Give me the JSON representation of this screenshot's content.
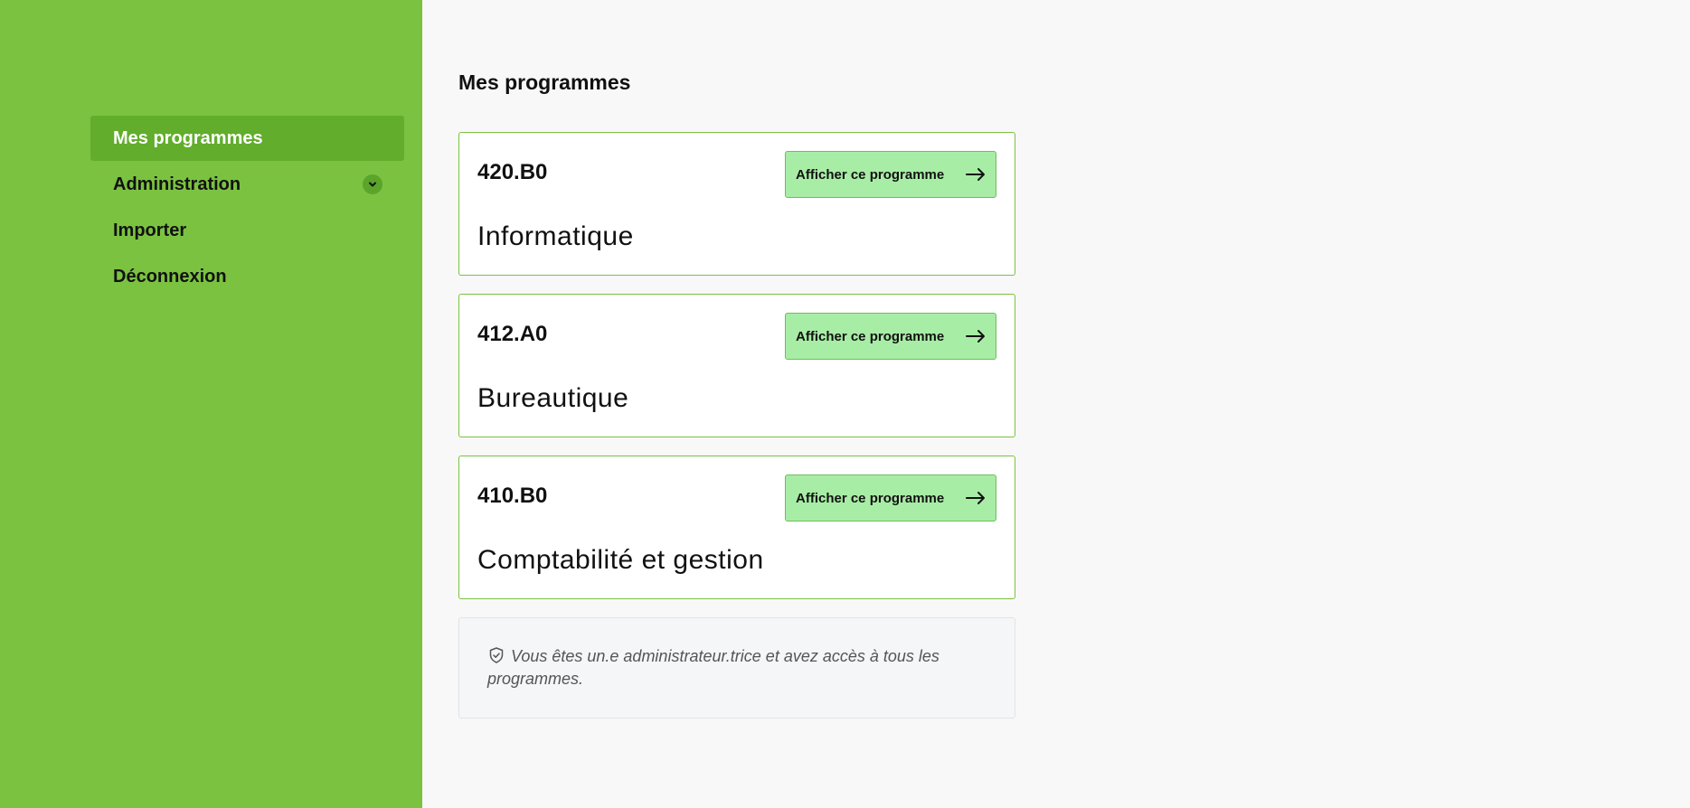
{
  "sidebar": {
    "items": [
      {
        "label": "Mes programmes"
      },
      {
        "label": "Administration"
      },
      {
        "label": "Importer"
      },
      {
        "label": "Déconnexion"
      }
    ]
  },
  "main": {
    "title": "Mes programmes",
    "button_label": "Afficher ce programme",
    "programs": [
      {
        "code": "420.B0",
        "name": "Informatique"
      },
      {
        "code": "412.A0",
        "name": "Bureautique"
      },
      {
        "code": "410.B0",
        "name": "Comptabilité et gestion"
      }
    ],
    "notice": "Vous êtes un.e administrateur.trice et avez accès à tous les programmes."
  },
  "colors": {
    "sidebar": "#7bc241",
    "sidebar_active": "#62ad2c",
    "button": "#a8eda6"
  }
}
